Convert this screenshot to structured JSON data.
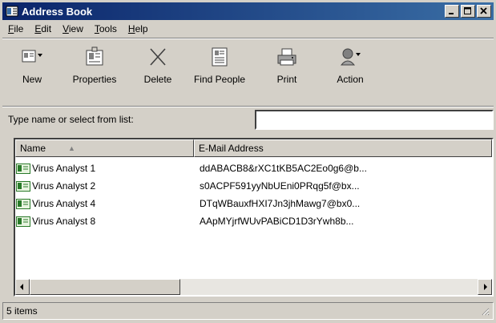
{
  "window": {
    "title": "Address Book"
  },
  "titlebar_buttons": {
    "minimize": "_",
    "maximize": "□",
    "close": "×"
  },
  "menu": [
    {
      "label": "File",
      "ul": "F",
      "rest": "ile"
    },
    {
      "label": "Edit",
      "ul": "E",
      "rest": "dit"
    },
    {
      "label": "View",
      "ul": "V",
      "rest": "iew"
    },
    {
      "label": "Tools",
      "ul": "T",
      "rest": "ools"
    },
    {
      "label": "Help",
      "ul": "H",
      "rest": "elp"
    }
  ],
  "toolbar": {
    "new_label": "New",
    "properties_label": "Properties",
    "delete_label": "Delete",
    "find_people_label": "Find People",
    "print_label": "Print",
    "action_label": "Action"
  },
  "search": {
    "label": "Type name or select from list:",
    "value": ""
  },
  "list": {
    "columns": [
      "Name",
      "E-Mail Address"
    ],
    "rows": [
      {
        "name": "Virus Analyst 1",
        "email": "ddABACB8&rXC1tKB5AC2Eo0g6@b..."
      },
      {
        "name": "Virus Analyst 2",
        "email": "s0ACPF591yyNbUEni0PRqg5f@bx..."
      },
      {
        "name": "Virus Analyst 4",
        "email": "DTqWBauxfHXI7Jn3jhMawg7@bx0..."
      },
      {
        "name": "Virus Analyst 8",
        "email": "AApMYjrfWUvPABiCD1D3rYwh8b..."
      }
    ]
  },
  "status": {
    "text": "5 items"
  },
  "colors": {
    "titlebar_start": "#0a246a",
    "titlebar_end": "#3a6ea5",
    "face": "#d4d0c8"
  }
}
